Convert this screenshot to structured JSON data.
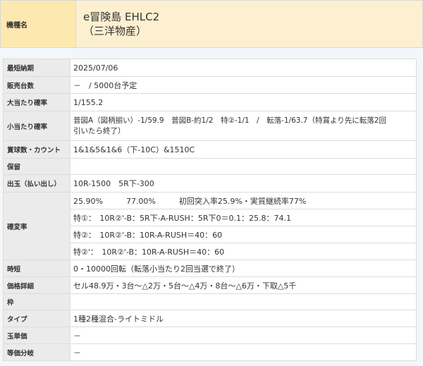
{
  "header": {
    "label": "機種名",
    "name_line1": "e冒険島 EHLC2",
    "name_line2": "（三洋物産）"
  },
  "rows": {
    "delivery": {
      "label": "最短納期",
      "value": "2025/07/06"
    },
    "units": {
      "label": "販売台数",
      "value": "－　/ 5000台予定"
    },
    "jackpot": {
      "label": "大当たり確率",
      "value": "1/155.2"
    },
    "small": {
      "label": "小当たり確率",
      "value_line1": "普図A（図柄揃い）-1/59.9　普図B-約1/2　特②-1/1　/　転落-1/63.7（特賞より先に転落2回",
      "value_line2": "引いたら終了）"
    },
    "payout_count": {
      "label": "賞球数・カウント",
      "value": "1&1&5&1&6（下-10C）&1510C"
    },
    "hold": {
      "label": "保留",
      "value": ""
    },
    "payout": {
      "label": "出玉（払い出し）",
      "value": "10R-1500　5R下-300"
    },
    "kakuhen": {
      "label": "確変率",
      "line1": "25.90%　　　77.00%　　　初回突入率25.9%・実質継続率77%",
      "line2": "特①：　10R②'-B：5R下-A-RUSH：5R下0＝0.1：25.8：74.1",
      "line3": "特②：　10R②'-B：10R-A-RUSH＝40：60",
      "line4": "特②'：　10R②'-B：10R-A-RUSH＝40：60"
    },
    "jitan": {
      "label": "時短",
      "value": "0・10000回転（転落小当たり2回当選で終了）"
    },
    "price": {
      "label": "価格詳細",
      "value": "セル48.9万・3台～△2万・5台～△4万・8台～△6万・下取△5千"
    },
    "frame": {
      "label": "枠",
      "value": ""
    },
    "type": {
      "label": "タイプ",
      "value": "1種2種混合-ライトミドル"
    },
    "ball_price": {
      "label": "玉単価",
      "value": "－"
    },
    "equal_div": {
      "label": "等価分岐",
      "value": "－"
    }
  },
  "colors": {
    "header_label_bg": "#fde8b0",
    "header_value_bg": "#fdf0d0",
    "row_label_bg": "#ebebeb",
    "price_text": "#b52a2a"
  }
}
